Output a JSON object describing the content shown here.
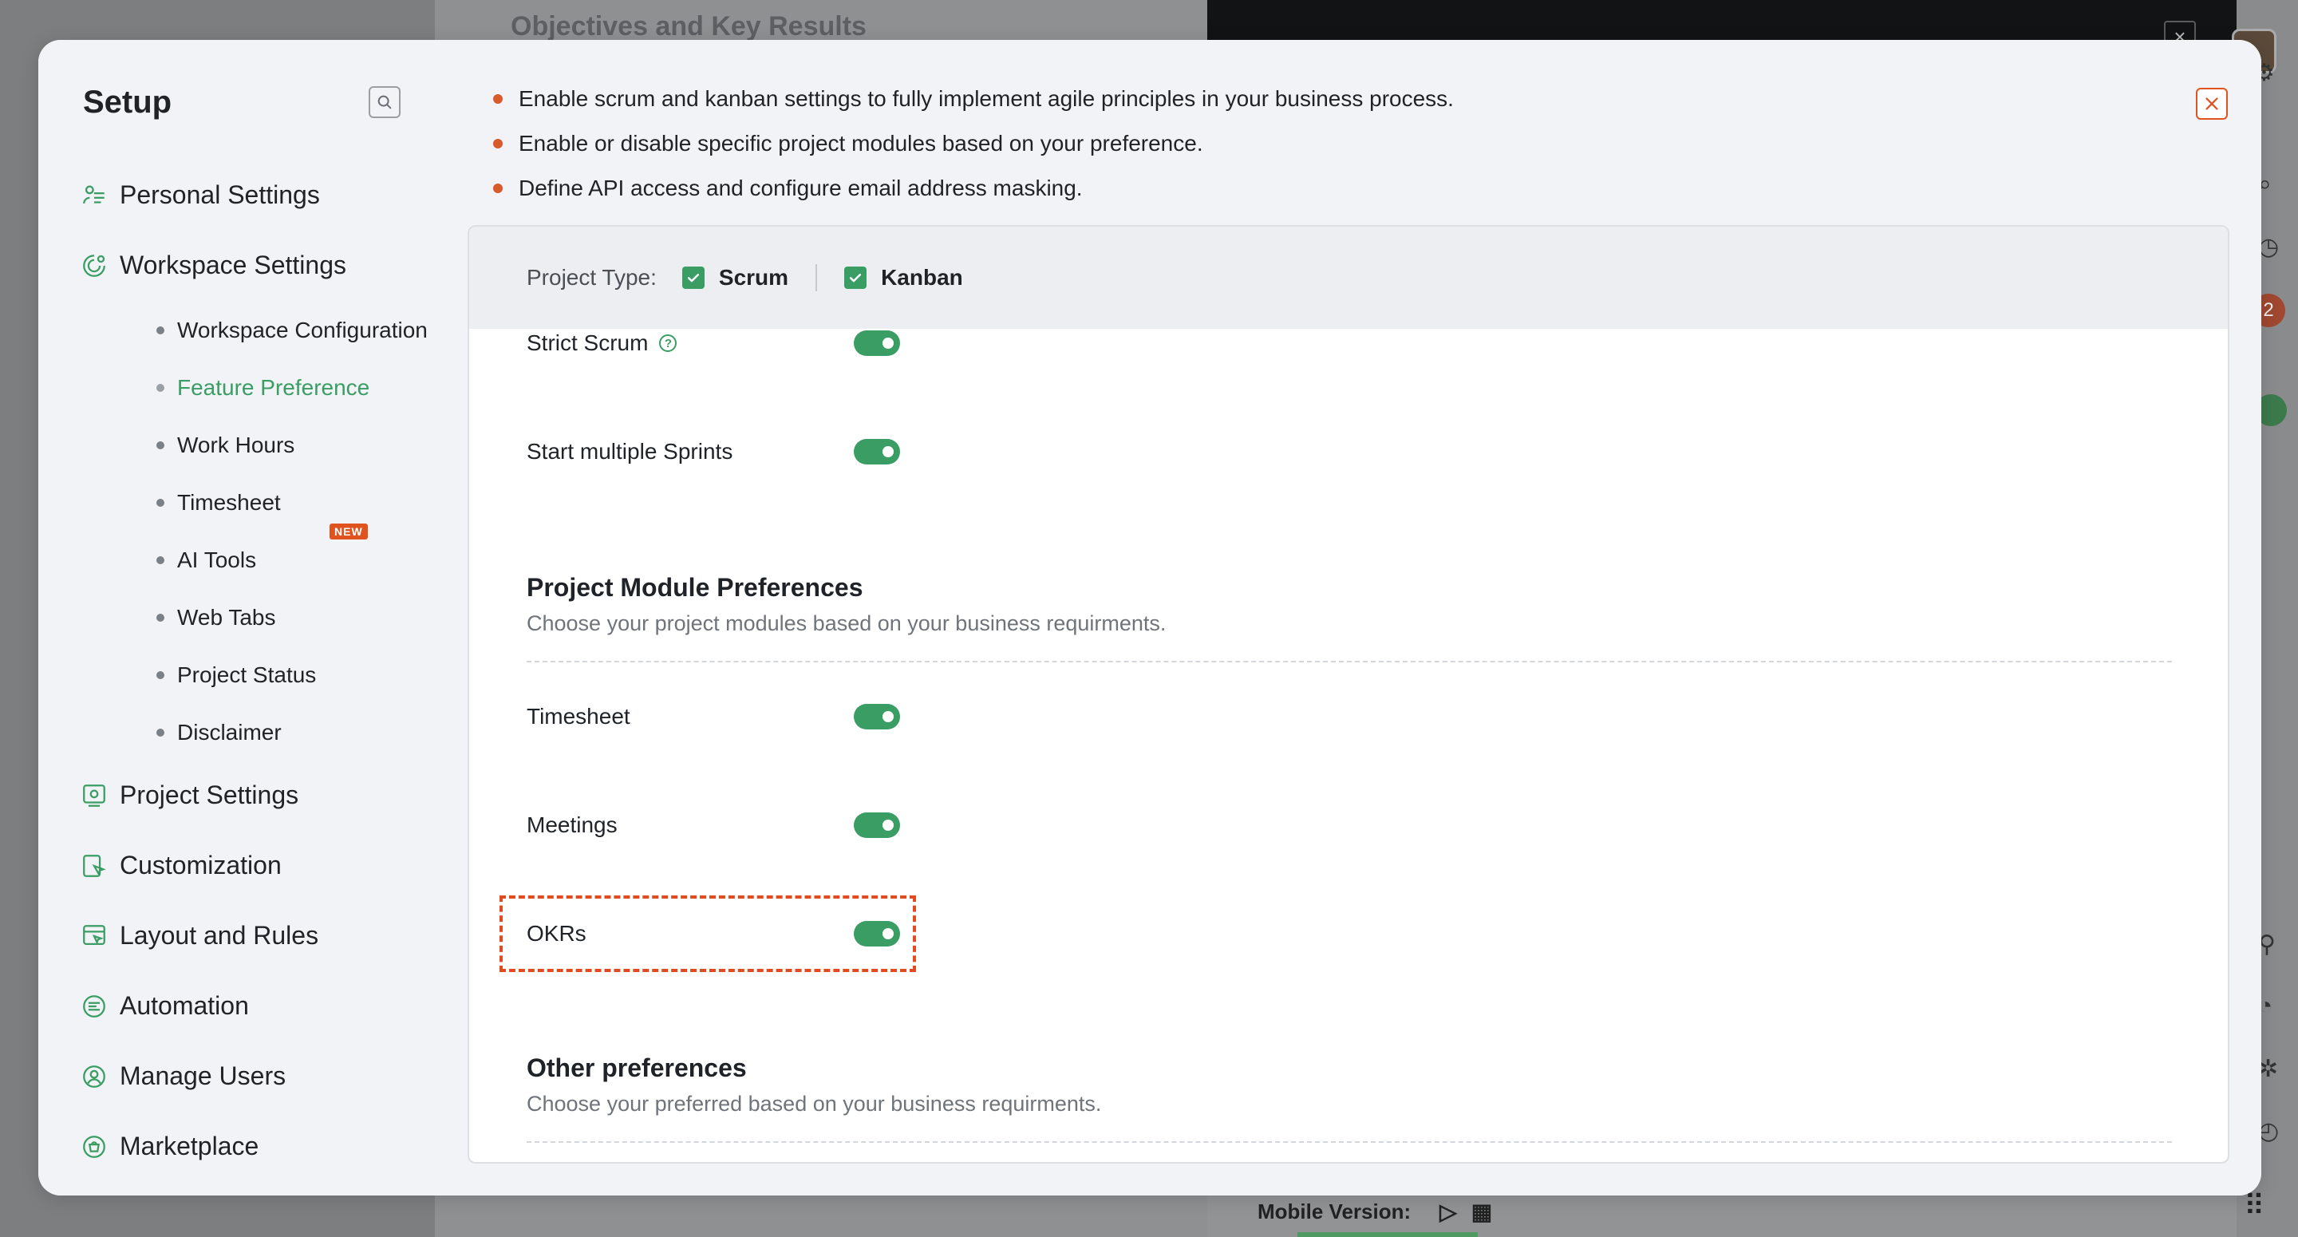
{
  "background": {
    "title": "Objectives and Key Results",
    "footer_label": "Mobile Version:",
    "badge_count": "2"
  },
  "sidebar": {
    "title": "Setup",
    "items": [
      {
        "label": "Personal Settings",
        "icon": "personal-settings-icon"
      },
      {
        "label": "Workspace Settings",
        "icon": "workspace-settings-icon"
      },
      {
        "label": "Project Settings",
        "icon": "project-settings-icon"
      },
      {
        "label": "Customization",
        "icon": "customization-icon"
      },
      {
        "label": "Layout and Rules",
        "icon": "layout-rules-icon"
      },
      {
        "label": "Automation",
        "icon": "automation-icon"
      },
      {
        "label": "Manage Users",
        "icon": "manage-users-icon"
      },
      {
        "label": "Marketplace",
        "icon": "marketplace-icon"
      }
    ],
    "workspace_sub": [
      {
        "label": "Workspace Configuration",
        "active": false
      },
      {
        "label": "Feature Preference",
        "active": true
      },
      {
        "label": "Work Hours",
        "active": false
      },
      {
        "label": "Timesheet",
        "active": false
      },
      {
        "label": "AI Tools",
        "active": false,
        "badge": "NEW"
      },
      {
        "label": "Web Tabs",
        "active": false
      },
      {
        "label": "Project Status",
        "active": false
      },
      {
        "label": "Disclaimer",
        "active": false
      }
    ]
  },
  "main": {
    "bullets": [
      "Enable scrum and kanban settings to fully implement agile principles in your business process.",
      "Enable or disable specific project modules based on your preference.",
      "Define API access and configure email address masking."
    ],
    "project_type": {
      "label": "Project Type:",
      "options": [
        {
          "label": "Scrum",
          "checked": true
        },
        {
          "label": "Kanban",
          "checked": true
        }
      ]
    },
    "scrum_settings": [
      {
        "label": "Strict Scrum",
        "enabled": true,
        "help": true
      },
      {
        "label": "Start multiple Sprints",
        "enabled": true,
        "help": false
      }
    ],
    "module_section": {
      "title": "Project Module Preferences",
      "description": "Choose your project modules based on your business requirments."
    },
    "modules": [
      {
        "label": "Timesheet",
        "enabled": true
      },
      {
        "label": "Meetings",
        "enabled": true
      },
      {
        "label": "OKRs",
        "enabled": true
      }
    ],
    "other_section": {
      "title": "Other preferences",
      "description": "Choose your preferred based on your business requirments."
    }
  },
  "colors": {
    "accent_green": "#3a9e64",
    "highlight_red": "#e24a1f",
    "bullet_orange": "#d95a2b"
  }
}
